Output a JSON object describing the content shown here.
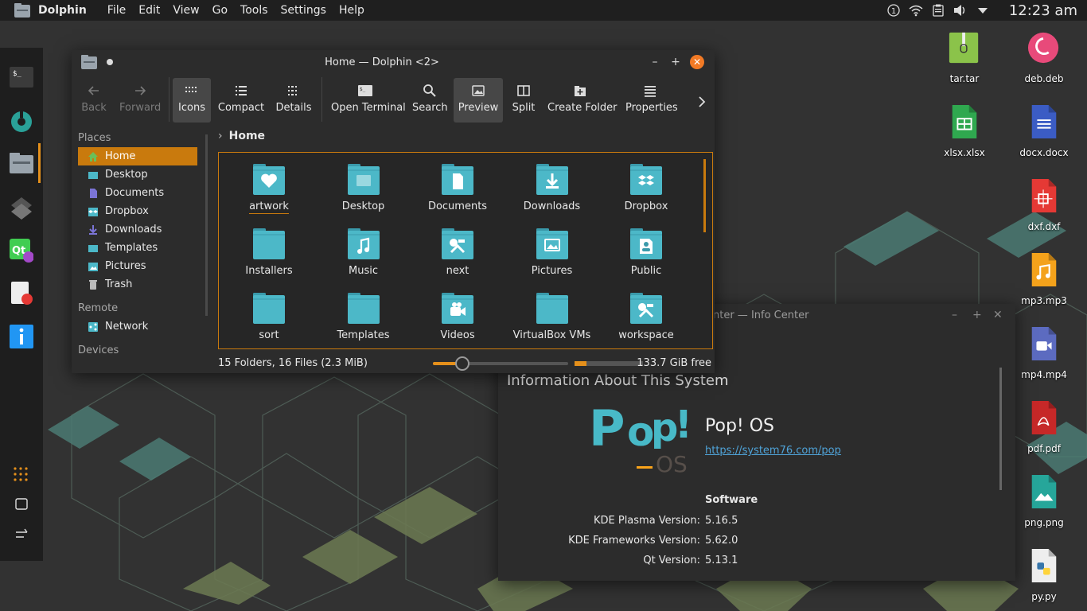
{
  "topbar": {
    "app_name": "Dolphin",
    "menu": [
      "File",
      "Edit",
      "View",
      "Go",
      "Tools",
      "Settings",
      "Help"
    ],
    "clock": "12:23 am",
    "notification_count": "1"
  },
  "desktop": {
    "icons": [
      {
        "label": "tar.tar",
        "icon": "archive-icon",
        "color": "#8bc34a"
      },
      {
        "label": "deb.deb",
        "icon": "debian-icon",
        "color": "#e84a7a"
      },
      {
        "label": "xlsx.xlsx",
        "icon": "spreadsheet-icon",
        "color": "#2fa84f"
      },
      {
        "label": "docx.docx",
        "icon": "document-icon",
        "color": "#3b5cc4"
      },
      {
        "label": "dxf.dxf",
        "icon": "drawing-icon",
        "color": "#e53935"
      },
      {
        "label": "mp3.mp3",
        "icon": "audio-icon",
        "color": "#f4a21b"
      },
      {
        "label": "mp4.mp4",
        "icon": "video-icon",
        "color": "#5c6bc0"
      },
      {
        "label": "pdf.pdf",
        "icon": "pdf-icon",
        "color": "#c62828"
      },
      {
        "label": "png.png",
        "icon": "image-icon",
        "color": "#26a69a"
      },
      {
        "label": "py.py",
        "icon": "python-icon",
        "color": "#eeeeee"
      }
    ]
  },
  "dolphin": {
    "title": "Home — Dolphin <2>",
    "toolbar": {
      "back": "Back",
      "forward": "Forward",
      "icons": "Icons",
      "compact": "Compact",
      "details": "Details",
      "open_terminal": "Open Terminal",
      "search": "Search",
      "preview": "Preview",
      "split": "Split",
      "create_folder": "Create Folder",
      "properties": "Properties"
    },
    "places": {
      "places_header": "Places",
      "items": [
        "Home",
        "Desktop",
        "Documents",
        "Dropbox",
        "Downloads",
        "Templates",
        "Pictures",
        "Trash"
      ],
      "remote_header": "Remote",
      "remote_items": [
        "Network"
      ],
      "devices_header": "Devices"
    },
    "breadcrumb": "Home",
    "files": [
      {
        "name": "artwork",
        "glyph": "heart"
      },
      {
        "name": "Desktop",
        "glyph": "desktop"
      },
      {
        "name": "Documents",
        "glyph": "doc"
      },
      {
        "name": "Downloads",
        "glyph": "download"
      },
      {
        "name": "Dropbox",
        "glyph": "dropbox"
      },
      {
        "name": "Installers",
        "glyph": "none"
      },
      {
        "name": "Music",
        "glyph": "music"
      },
      {
        "name": "next",
        "glyph": "tools"
      },
      {
        "name": "Pictures",
        "glyph": "picture"
      },
      {
        "name": "Public",
        "glyph": "user"
      },
      {
        "name": "sort",
        "glyph": "none"
      },
      {
        "name": "Templates",
        "glyph": "none"
      },
      {
        "name": "Videos",
        "glyph": "video"
      },
      {
        "name": "VirtualBox VMs",
        "glyph": "none"
      },
      {
        "name": "workspace",
        "glyph": "tools"
      }
    ],
    "status": {
      "count": "15 Folders, 16 Files (2.3 MiB)",
      "free": "133.7 GiB free",
      "zoom_fraction": 0.22,
      "disk_used_fraction": 0.17
    }
  },
  "info_center": {
    "title": "enter — Info Center",
    "heading": "Information About This System",
    "os_name": "Pop! OS",
    "os_url": "https://system76.com/pop",
    "software_header": "Software",
    "rows": [
      {
        "key": "KDE Plasma Version:",
        "value": "5.16.5"
      },
      {
        "key": "KDE Frameworks Version:",
        "value": "5.62.0"
      },
      {
        "key": "Qt Version:",
        "value": "5.13.1"
      }
    ]
  },
  "colors": {
    "accent": "#c97a0d",
    "folder": "#4cb8c8",
    "folder_dark": "#3a9aab",
    "panel": "#1f1f1f"
  }
}
